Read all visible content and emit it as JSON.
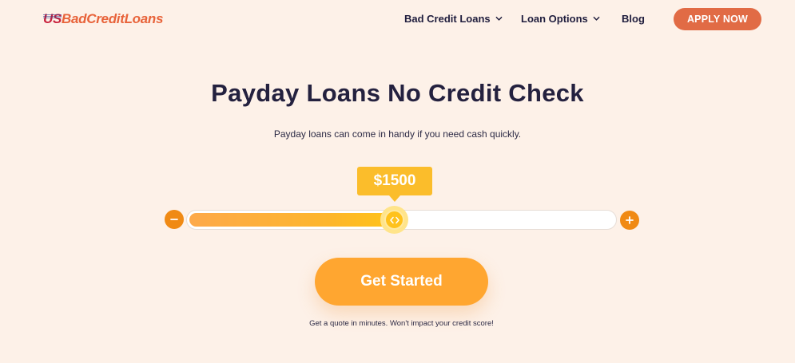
{
  "header": {
    "logo_us": "US",
    "logo_rest": "BadCreditLoans",
    "nav": [
      {
        "label": "Bad Credit Loans",
        "icon": "chevron-down-icon"
      },
      {
        "label": "Loan Options",
        "icon": "chevron-down-icon"
      },
      {
        "label": "Blog"
      }
    ],
    "apply_label": "APPLY NOW"
  },
  "hero": {
    "title": "Payday Loans No Credit Check",
    "subtitle": "Payday loans can come in handy if you need cash quickly."
  },
  "slider": {
    "value_label": "$1500",
    "fill_fraction": 0.47,
    "minus_icon": "minus-icon",
    "plus_icon": "plus-icon",
    "thumb_icon": "code-arrows-icon"
  },
  "cta": {
    "label": "Get Started",
    "note": "Get a quote in minutes. Won't impact your credit score!"
  },
  "colors": {
    "background": "#fdf1e8",
    "accent": "#e16b45",
    "cta": "#ffa630",
    "slider_fill": "#fdb62c",
    "control": "#f08a14"
  }
}
